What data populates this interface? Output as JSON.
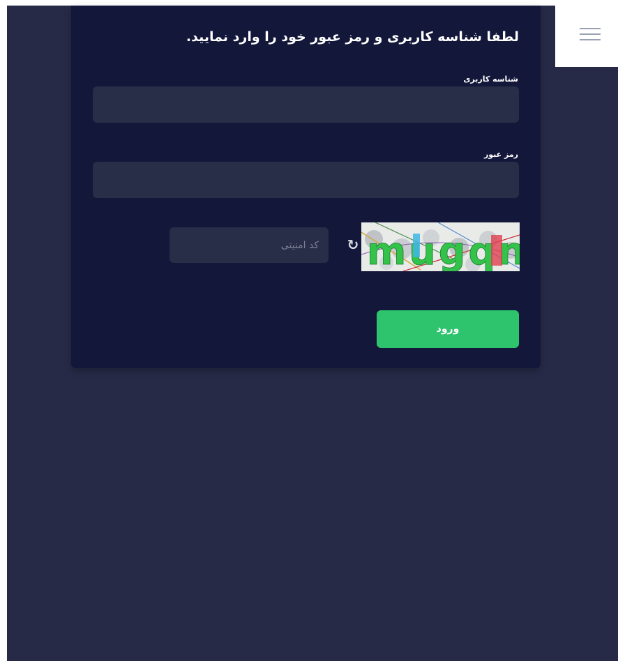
{
  "login": {
    "title": "لطفا شناسه کاربری و رمز عبور خود را وارد نمایید.",
    "username_label": "شناسه کاربری",
    "username_value": "",
    "password_label": "رمز عبور",
    "password_value": "",
    "captcha_placeholder": "کد امنیتی",
    "captcha_value": "",
    "captcha_text": "mugqn",
    "submit_label": "ورود"
  },
  "icons": {
    "menu": "hamburger-menu-icon",
    "refresh": "refresh-icon"
  },
  "colors": {
    "page_background": "#272a47",
    "card_background": "#13173a",
    "input_background": "#282d48",
    "submit_button": "#2ec36d"
  }
}
